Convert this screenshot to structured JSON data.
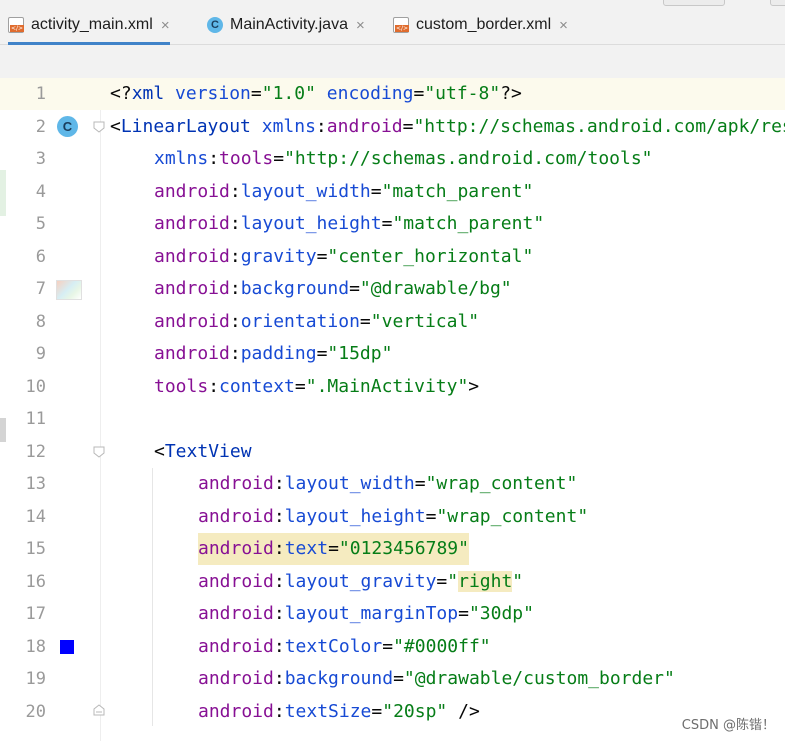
{
  "tabs": [
    {
      "label": "activity_main.xml",
      "icon": "xml-file-icon",
      "active": true
    },
    {
      "label": "MainActivity.java",
      "icon": "java-class-icon",
      "active": false
    },
    {
      "label": "custom_border.xml",
      "icon": "xml-file-icon",
      "active": false
    }
  ],
  "tab_close_glyph": "×",
  "gutter": {
    "class_icon_letter": "C",
    "text_color_swatch": "#0000ff"
  },
  "lines": [
    {
      "num": "1"
    },
    {
      "num": "2"
    },
    {
      "num": "3"
    },
    {
      "num": "4"
    },
    {
      "num": "5"
    },
    {
      "num": "6"
    },
    {
      "num": "7"
    },
    {
      "num": "8"
    },
    {
      "num": "9"
    },
    {
      "num": "10"
    },
    {
      "num": "11"
    },
    {
      "num": "12"
    },
    {
      "num": "13"
    },
    {
      "num": "14"
    },
    {
      "num": "15"
    },
    {
      "num": "16"
    },
    {
      "num": "17"
    },
    {
      "num": "18"
    },
    {
      "num": "19"
    },
    {
      "num": "20"
    }
  ],
  "code": {
    "l1_open": "<?",
    "l1_xml": "xml",
    "l1_version_attr": " version",
    "l1_version_val": "\"1.0\"",
    "l1_encoding_attr": " encoding",
    "l1_encoding_val": "\"utf-8\"",
    "l1_close": "?>",
    "l2_open": "<",
    "l2_tag": "LinearLayout",
    "l2_ns": " xmlns",
    "l2_colon": ":",
    "l2_attr": "android",
    "l2_val": "\"http://schemas.android.com/apk/res",
    "l3_ns": "xmlns",
    "l3_attr": "tools",
    "l3_val": "\"http://schemas.android.com/tools\"",
    "l4_ns": "android",
    "l4_attr": "layout_width",
    "l4_val": "\"match_parent\"",
    "l5_ns": "android",
    "l5_attr": "layout_height",
    "l5_val": "\"match_parent\"",
    "l6_ns": "android",
    "l6_attr": "gravity",
    "l6_val": "\"center_horizontal\"",
    "l7_ns": "android",
    "l7_attr": "background",
    "l7_val": "\"@drawable/bg\"",
    "l8_ns": "android",
    "l8_attr": "orientation",
    "l8_val": "\"vertical\"",
    "l9_ns": "android",
    "l9_attr": "padding",
    "l9_val": "\"15dp\"",
    "l10_ns": "tools",
    "l10_attr": "context",
    "l10_val": "\".MainActivity\"",
    "l10_close": ">",
    "l12_open": "<",
    "l12_tag": "TextView",
    "l13_ns": "android",
    "l13_attr": "layout_width",
    "l13_val": "\"wrap_content\"",
    "l14_ns": "android",
    "l14_attr": "layout_height",
    "l14_val": "\"wrap_content\"",
    "l15_ns": "android",
    "l15_attr": "text",
    "l15_val": "\"0123456789\"",
    "l16_ns": "android",
    "l16_attr": "layout_gravity",
    "l16_val_q1": "\"",
    "l16_val": "right",
    "l16_val_q2": "\"",
    "l17_ns": "android",
    "l17_attr": "layout_marginTop",
    "l17_val": "\"30dp\"",
    "l18_ns": "android",
    "l18_attr": "textColor",
    "l18_val": "\"#0000ff\"",
    "l19_ns": "android",
    "l19_attr": "background",
    "l19_val": "\"@drawable/custom_border\"",
    "l20_ns": "android",
    "l20_attr": "textSize",
    "l20_val": "\"20sp\"",
    "l20_close": " />",
    "eq": "="
  },
  "watermark": "CSDN @陈锴！"
}
